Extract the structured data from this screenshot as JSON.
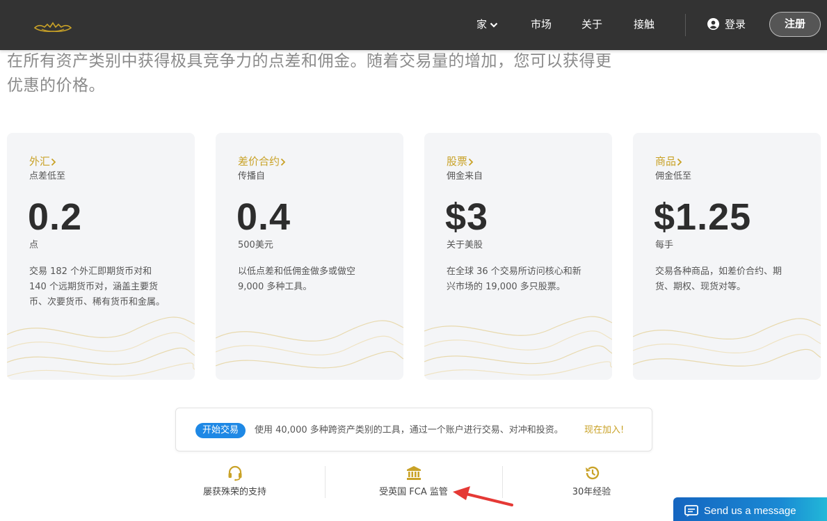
{
  "nav": {
    "items": [
      {
        "label": "家"
      },
      {
        "label": "市场"
      },
      {
        "label": "关于"
      },
      {
        "label": "接触"
      }
    ],
    "login_label": "登录",
    "register_label": "注册"
  },
  "intro": {
    "text": "在所有资产类别中获得极具竞争力的点差和佣金。随着交易量的增加，您可以获得更优惠的价格。"
  },
  "cards": [
    {
      "title": "外汇",
      "subtitle": "点差低至",
      "value": "0.2",
      "unit": "点",
      "description": "交易 182 个外汇即期货币对和 140 个远期货币对，涵盖主要货币、次要货币、稀有货币和金属。"
    },
    {
      "title": "差价合约",
      "subtitle": "传播自",
      "value": "0.4",
      "unit": "500美元",
      "description": "以低点差和低佣金做多或做空 9,000 多种工具。"
    },
    {
      "title": "股票",
      "subtitle": "佣金来自",
      "value": "$3",
      "unit": "关于美股",
      "description": "在全球 36 个交易所访问核心和新兴市场的 19,000 多只股票。"
    },
    {
      "title": "商品",
      "subtitle": "佣金低至",
      "value": "$1.25",
      "unit": "每手",
      "description": "交易各种商品，如差价合约、期货、期权、现货对等。"
    }
  ],
  "cta": {
    "badge": "开始交易",
    "text": "使用 40,000 多种跨资产类别的工具，通过一个账户进行交易、对冲和投资。",
    "link": "现在加入!"
  },
  "features": [
    {
      "icon": "headset-icon",
      "label": "屡获殊荣的支持"
    },
    {
      "icon": "bank-icon",
      "label": "受英国 FCA 监管"
    },
    {
      "icon": "history-icon",
      "label": "30年经验"
    }
  ],
  "chat": {
    "label": "Send us a message"
  },
  "colors": {
    "navbar": "#333333",
    "accent_gold": "#c9a227",
    "badge_blue": "#1e88e5",
    "card_bg": "#f4f5f7",
    "annotation_red": "#e53935"
  }
}
